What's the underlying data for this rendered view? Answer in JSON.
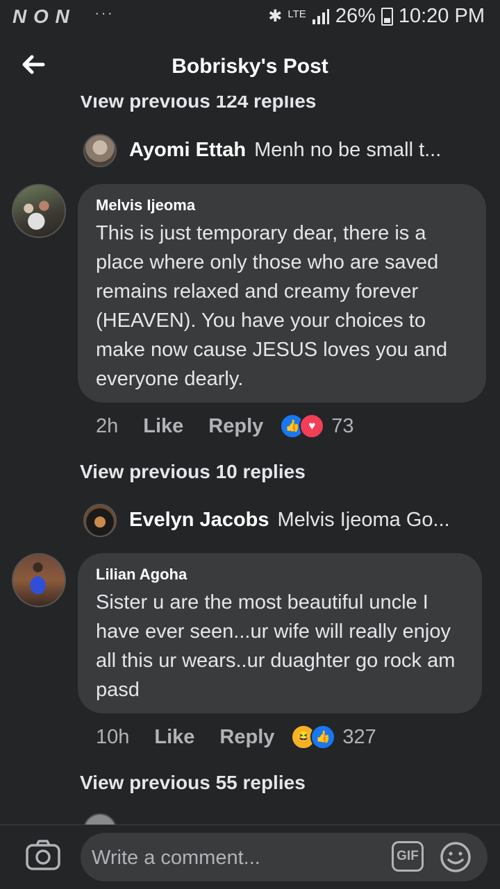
{
  "status_bar": {
    "left_icons": "N O N",
    "dots": "···",
    "network": "LTE",
    "signal_icon": "signal-icon",
    "battery": "26%",
    "time": "10:20 PM"
  },
  "header": {
    "title": "Bobrisky's Post",
    "back_icon": "arrow-left-icon"
  },
  "thread": {
    "top_view_previous": "View previous 124 replies",
    "reply_preview_1": {
      "name": "Ayomi Ettah",
      "text": "Menh no be small t..."
    },
    "comment_1": {
      "name": "Melvis Ijeoma",
      "text": "This is just temporary dear, there is a place where only those who are saved remains relaxed and creamy forever (HEAVEN). You have your choices to make now cause JESUS loves you and everyone dearly.",
      "time": "2h",
      "like": "Like",
      "reply": "Reply",
      "reaction_count": "73",
      "reactions": [
        "like",
        "love"
      ]
    },
    "view_previous_2": "View previous 10 replies",
    "reply_preview_2": {
      "name": "Evelyn Jacobs",
      "text": "Melvis Ijeoma Go..."
    },
    "comment_2": {
      "name": "Lilian Agoha",
      "text": "Sister u are the most beautiful uncle I have ever seen...ur wife will really enjoy all this ur wears..ur duaghter go rock am pasd",
      "time": "10h",
      "like": "Like",
      "reply": "Reply",
      "reaction_count": "327",
      "reactions": [
        "haha",
        "like"
      ]
    },
    "view_previous_3": "View previous 55 replies"
  },
  "composer": {
    "placeholder": "Write a comment...",
    "gif_label": "GIF",
    "camera_icon": "camera-icon",
    "emoji_icon": "smiley-icon"
  },
  "colors": {
    "background": "#242526",
    "bubble": "#3a3b3c",
    "like_blue": "#1877f2",
    "love_red": "#f33e58",
    "haha_yellow": "#f7b125"
  }
}
